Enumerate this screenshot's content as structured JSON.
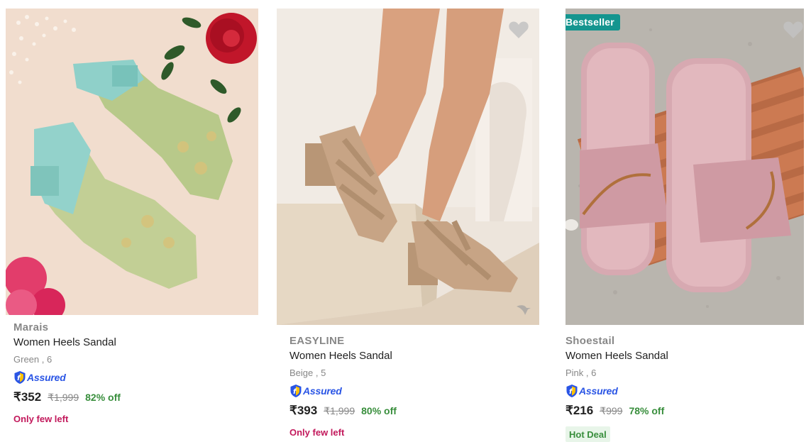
{
  "colors": {
    "assured_blue": "#2a55e5",
    "discount_green": "#388e3c",
    "few_left_pink": "#c2185b",
    "bestseller_teal": "#14958f"
  },
  "products": [
    {
      "brand": "Marais",
      "title": "Women Heels Sandal",
      "variant": "Green , 6",
      "assured_label": "Assured",
      "price": "₹352",
      "mrp": "₹1,999",
      "discount": "82% off",
      "stock_note": "Only few left",
      "image_icon": "green-sequin-mule-photo"
    },
    {
      "brand": "EASYLINE",
      "title": "Women Heels Sandal",
      "variant": "Beige , 5",
      "assured_label": "Assured",
      "price": "₹393",
      "mrp": "₹1,999",
      "discount": "80% off",
      "stock_note": "Only few left",
      "image_icon": "beige-strappy-block-heel-photo",
      "wishlist_icon": "heart-icon"
    },
    {
      "badge": "Bestseller",
      "brand": "Shoestail",
      "title": "Women Heels Sandal",
      "variant": "Pink , 6",
      "assured_label": "Assured",
      "price": "₹216",
      "mrp": "₹999",
      "discount": "78% off",
      "deal_tag": "Hot Deal",
      "image_icon": "pink-slide-sandal-photo",
      "wishlist_icon": "heart-icon"
    }
  ]
}
